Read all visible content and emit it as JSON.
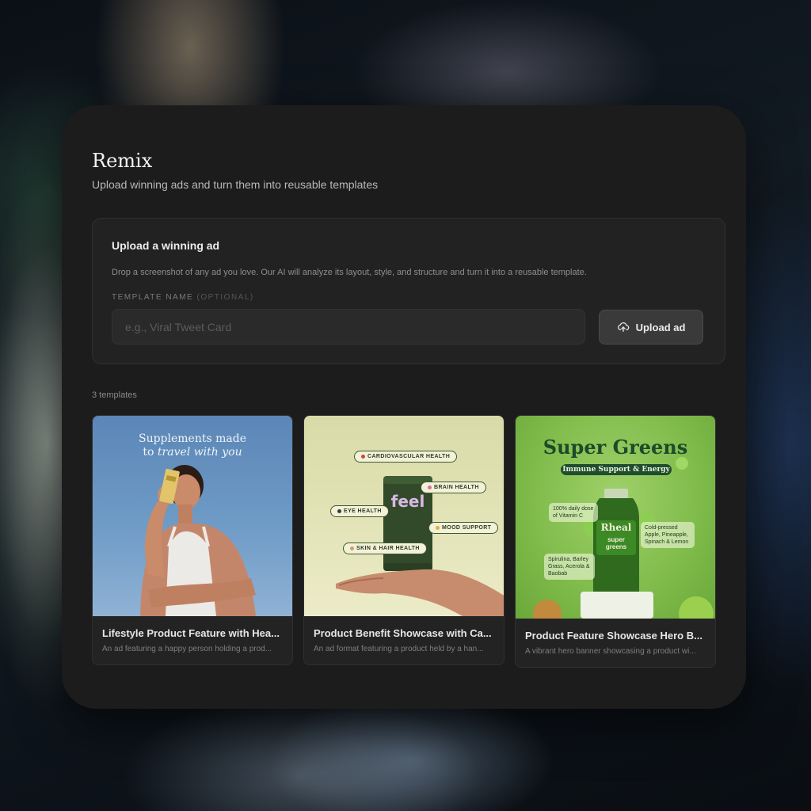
{
  "page": {
    "title": "Remix",
    "subtitle": "Upload winning ads and turn them into reusable templates"
  },
  "upload": {
    "heading": "Upload a winning ad",
    "description": "Drop a screenshot of any ad you love. Our AI will analyze its layout, style, and structure and turn it into a reusable template.",
    "field_label": "TEMPLATE NAME",
    "field_optional": "(OPTIONAL)",
    "placeholder": "e.g., Viral Tweet Card",
    "value": "",
    "button_label": "Upload ad",
    "button_icon": "cloud-upload-icon"
  },
  "templates": {
    "count_label": "3 templates",
    "items": [
      {
        "title": "Lifestyle Product Feature with Hea...",
        "description": "An ad featuring a happy person holding a prod...",
        "thumb": {
          "headline_line1": "Supplements made",
          "headline_line2": "to ",
          "headline_italic": "travel with you"
        }
      },
      {
        "title": "Product Benefit Showcase with Ca...",
        "description": "An ad format featuring a product held by a han...",
        "thumb": {
          "brand": "feel",
          "tags": [
            "CARDIOVASCULAR HEALTH",
            "BRAIN HEALTH",
            "EYE HEALTH",
            "MOOD SUPPORT",
            "SKIN & HAIR HEALTH"
          ]
        }
      },
      {
        "title": "Product Feature Showcase Hero B...",
        "description": "A vibrant hero banner showcasing a product wi...",
        "thumb": {
          "headline": "Super Greens",
          "tagline": "Immune Support & Energy",
          "note_left": "100% daily dose of Vitamin C",
          "note_right": "Cold-pressed Apple, Pineapple, Spinach & Lemon",
          "note_bottom": "Spirulina, Barley Grass, Acerola & Baobab",
          "brand": "Rheal",
          "bottle_text": "super greens"
        }
      }
    ]
  },
  "colors": {
    "panel": "#1c1c1d",
    "card": "#232324",
    "accent_green": "#1f4d2d"
  }
}
